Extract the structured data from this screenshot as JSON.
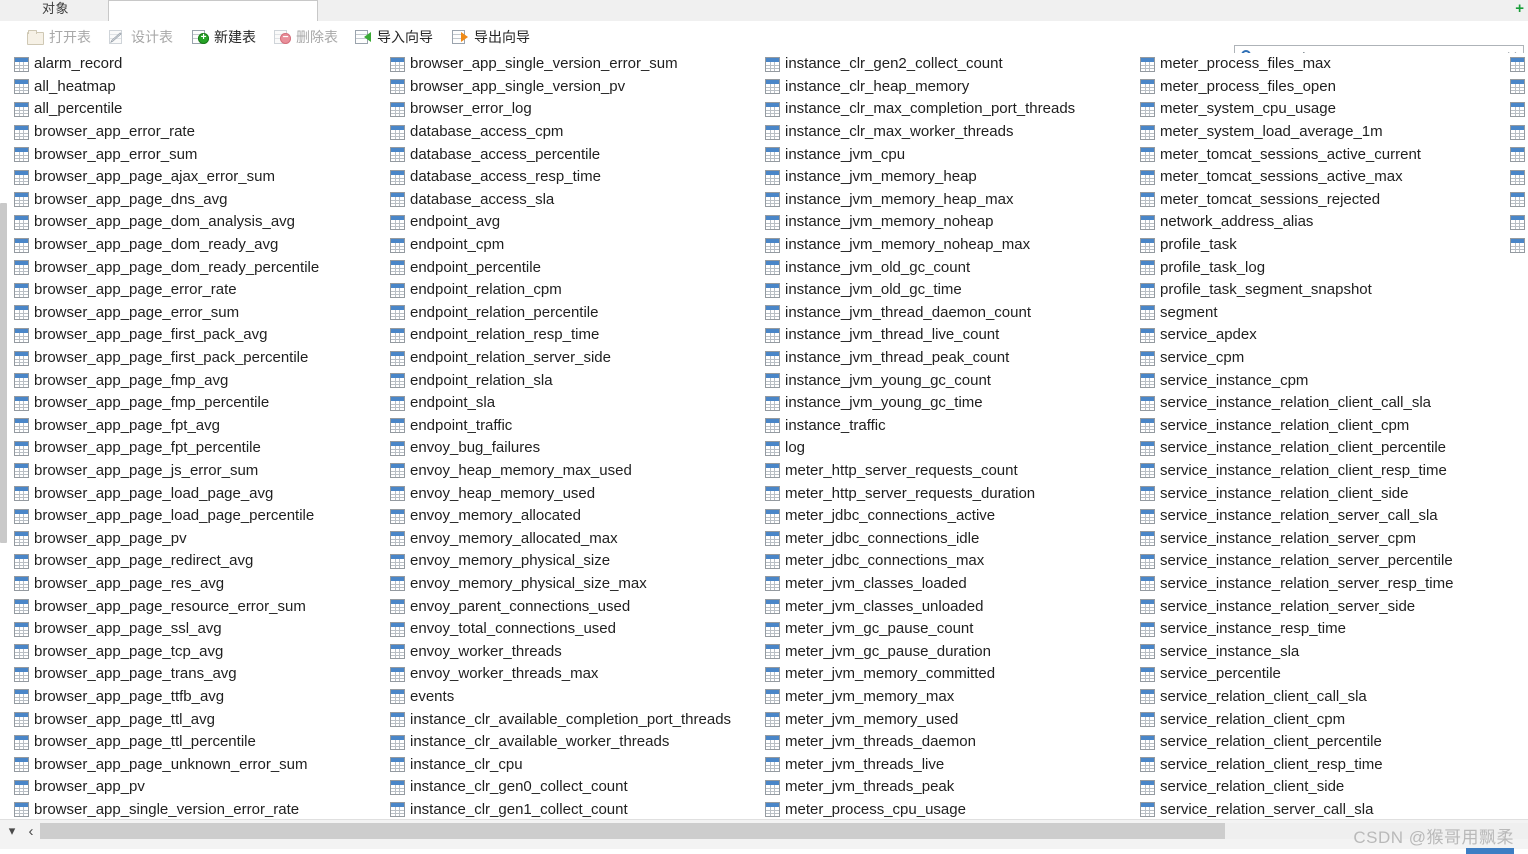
{
  "window": {
    "tab_label": "对象",
    "add_tab_icon": "plus-icon"
  },
  "toolbar": {
    "items": [
      {
        "label": "打开表",
        "icon": "open-table-icon",
        "enabled": false
      },
      {
        "label": "设计表",
        "icon": "design-table-icon",
        "enabled": false
      },
      {
        "label": "新建表",
        "icon": "new-table-icon",
        "enabled": true
      },
      {
        "label": "删除表",
        "icon": "delete-table-icon",
        "enabled": false
      },
      {
        "label": "导入向导",
        "icon": "import-wizard-icon",
        "enabled": true
      },
      {
        "label": "导出向导",
        "icon": "export-wizard-icon",
        "enabled": true
      }
    ]
  },
  "search": {
    "placeholder": "Search",
    "value": "",
    "icon": "search-icon",
    "clear_icon": "close-icon"
  },
  "list": {
    "item_icon": "table-icon",
    "columns": [
      {
        "items": [
          "alarm_record",
          "all_heatmap",
          "all_percentile",
          "browser_app_error_rate",
          "browser_app_error_sum",
          "browser_app_page_ajax_error_sum",
          "browser_app_page_dns_avg",
          "browser_app_page_dom_analysis_avg",
          "browser_app_page_dom_ready_avg",
          "browser_app_page_dom_ready_percentile",
          "browser_app_page_error_rate",
          "browser_app_page_error_sum",
          "browser_app_page_first_pack_avg",
          "browser_app_page_first_pack_percentile",
          "browser_app_page_fmp_avg",
          "browser_app_page_fmp_percentile",
          "browser_app_page_fpt_avg",
          "browser_app_page_fpt_percentile",
          "browser_app_page_js_error_sum",
          "browser_app_page_load_page_avg",
          "browser_app_page_load_page_percentile",
          "browser_app_page_pv",
          "browser_app_page_redirect_avg",
          "browser_app_page_res_avg",
          "browser_app_page_resource_error_sum",
          "browser_app_page_ssl_avg",
          "browser_app_page_tcp_avg",
          "browser_app_page_trans_avg",
          "browser_app_page_ttfb_avg",
          "browser_app_page_ttl_avg",
          "browser_app_page_ttl_percentile",
          "browser_app_page_unknown_error_sum",
          "browser_app_pv",
          "browser_app_single_version_error_rate"
        ]
      },
      {
        "items": [
          "browser_app_single_version_error_sum",
          "browser_app_single_version_pv",
          "browser_error_log",
          "database_access_cpm",
          "database_access_percentile",
          "database_access_resp_time",
          "database_access_sla",
          "endpoint_avg",
          "endpoint_cpm",
          "endpoint_percentile",
          "endpoint_relation_cpm",
          "endpoint_relation_percentile",
          "endpoint_relation_resp_time",
          "endpoint_relation_server_side",
          "endpoint_relation_sla",
          "endpoint_sla",
          "endpoint_traffic",
          "envoy_bug_failures",
          "envoy_heap_memory_max_used",
          "envoy_heap_memory_used",
          "envoy_memory_allocated",
          "envoy_memory_allocated_max",
          "envoy_memory_physical_size",
          "envoy_memory_physical_size_max",
          "envoy_parent_connections_used",
          "envoy_total_connections_used",
          "envoy_worker_threads",
          "envoy_worker_threads_max",
          "events",
          "instance_clr_available_completion_port_threads",
          "instance_clr_available_worker_threads",
          "instance_clr_cpu",
          "instance_clr_gen0_collect_count",
          "instance_clr_gen1_collect_count"
        ]
      },
      {
        "items": [
          "instance_clr_gen2_collect_count",
          "instance_clr_heap_memory",
          "instance_clr_max_completion_port_threads",
          "instance_clr_max_worker_threads",
          "instance_jvm_cpu",
          "instance_jvm_memory_heap",
          "instance_jvm_memory_heap_max",
          "instance_jvm_memory_noheap",
          "instance_jvm_memory_noheap_max",
          "instance_jvm_old_gc_count",
          "instance_jvm_old_gc_time",
          "instance_jvm_thread_daemon_count",
          "instance_jvm_thread_live_count",
          "instance_jvm_thread_peak_count",
          "instance_jvm_young_gc_count",
          "instance_jvm_young_gc_time",
          "instance_traffic",
          "log",
          "meter_http_server_requests_count",
          "meter_http_server_requests_duration",
          "meter_jdbc_connections_active",
          "meter_jdbc_connections_idle",
          "meter_jdbc_connections_max",
          "meter_jvm_classes_loaded",
          "meter_jvm_classes_unloaded",
          "meter_jvm_gc_pause_count",
          "meter_jvm_gc_pause_duration",
          "meter_jvm_memory_committed",
          "meter_jvm_memory_max",
          "meter_jvm_memory_used",
          "meter_jvm_threads_daemon",
          "meter_jvm_threads_live",
          "meter_jvm_threads_peak",
          "meter_process_cpu_usage"
        ]
      },
      {
        "items": [
          "meter_process_files_max",
          "meter_process_files_open",
          "meter_system_cpu_usage",
          "meter_system_load_average_1m",
          "meter_tomcat_sessions_active_current",
          "meter_tomcat_sessions_active_max",
          "meter_tomcat_sessions_rejected",
          "network_address_alias",
          "profile_task",
          "profile_task_log",
          "profile_task_segment_snapshot",
          "segment",
          "service_apdex",
          "service_cpm",
          "service_instance_cpm",
          "service_instance_relation_client_call_sla",
          "service_instance_relation_client_cpm",
          "service_instance_relation_client_percentile",
          "service_instance_relation_client_resp_time",
          "service_instance_relation_client_side",
          "service_instance_relation_server_call_sla",
          "service_instance_relation_server_cpm",
          "service_instance_relation_server_percentile",
          "service_instance_relation_server_resp_time",
          "service_instance_relation_server_side",
          "service_instance_resp_time",
          "service_instance_sla",
          "service_percentile",
          "service_relation_client_call_sla",
          "service_relation_client_cpm",
          "service_relation_client_percentile",
          "service_relation_client_resp_time",
          "service_relation_client_side",
          "service_relation_server_call_sla"
        ]
      },
      {
        "clipped": true,
        "visible_icon_count": 9,
        "items": [
          "",
          "",
          "",
          "",
          "",
          "",
          "",
          "",
          ""
        ]
      }
    ]
  },
  "bottom": {
    "collapse_icon": "chevron-down-icon",
    "prev_icon": "chevron-left-icon",
    "watermark": "CSDN @猴哥用飘柔"
  }
}
